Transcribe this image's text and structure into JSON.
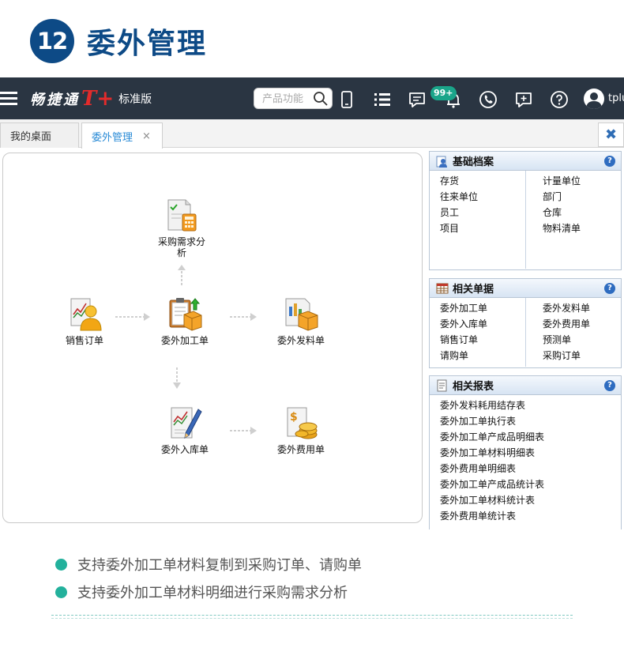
{
  "heading": {
    "number": "12",
    "title": "委外管理"
  },
  "topbar": {
    "brand_name": "畅捷通",
    "brand_tplus": "T+",
    "edition": "标准版",
    "search_placeholder": "产品功能",
    "badge": "99+",
    "user": "tplu"
  },
  "tabs": {
    "desk": "我的桌面",
    "active": "委外管理",
    "close_glyph": "×",
    "close_all_glyph": "✖"
  },
  "flow": {
    "nodes": {
      "demand": "采购需求分析",
      "sales": "销售订单",
      "process": "委外加工单",
      "issue": "委外发料单",
      "inbound": "委外入库单",
      "expense": "委外费用单"
    }
  },
  "sidebar": {
    "basic": {
      "title": "基础档案",
      "left": [
        "存货",
        "往来单位",
        "员工",
        "项目"
      ],
      "right": [
        "计量单位",
        "部门",
        "仓库",
        "物料清单"
      ]
    },
    "docs": {
      "title": "相关单据",
      "left": [
        "委外加工单",
        "委外入库单",
        "销售订单",
        "请购单"
      ],
      "right": [
        "委外发料单",
        "委外费用单",
        "预测单",
        "采购订单"
      ]
    },
    "reports": {
      "title": "相关报表",
      "items": [
        "委外发料耗用结存表",
        "委外加工单执行表",
        "委外加工单产成品明细表",
        "委外加工单材料明细表",
        "委外费用单明细表",
        "委外加工单产成品统计表",
        "委外加工单材料统计表",
        "委外费用单统计表"
      ]
    },
    "help_glyph": "?"
  },
  "bullets": [
    "支持委外加工单材料复制到采购订单、请购单",
    "支持委外加工单材料明细进行采购需求分析"
  ]
}
